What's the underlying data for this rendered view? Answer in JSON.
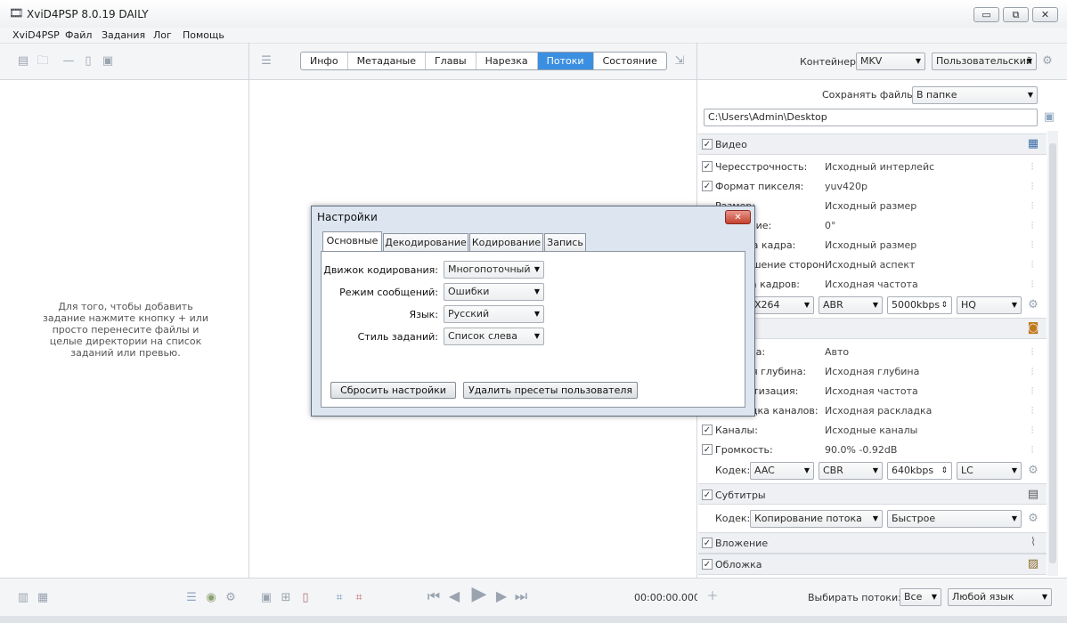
{
  "window": {
    "title": "XviD4PSP 8.0.19 DAILY",
    "min": "▭",
    "restore": "⧉",
    "close": "✕"
  },
  "menu": [
    "XviD4PSP",
    "Файл",
    "Задания",
    "Лог",
    "Помощь"
  ],
  "left_panel": {
    "hint": "Для того, чтобы добавить задание нажмите кнопку + или просто перенесите файлы и целые директории на список заданий или превью."
  },
  "tabs": [
    "Инфо",
    "Метаданые",
    "Главы",
    "Нарезка",
    "Потоки",
    "Состояние"
  ],
  "active_tab": "Потоки",
  "right_panel": {
    "container_label": "Контейнер:",
    "container_value": "MKV",
    "preset_value": "Пользовательский",
    "save_label": "Сохранять файлы:",
    "save_value": "В папке",
    "path": "C:\\Users\\Admin\\Desktop",
    "video": {
      "title": "Видео",
      "rows": [
        {
          "label": "Чересстрочность:",
          "value": "Исходный интерлейс"
        },
        {
          "label": "Формат пикселя:",
          "value": "yuv420p"
        },
        {
          "label": "Размер:",
          "value": "Исходный размер"
        },
        {
          "label": "Вращение:",
          "value": "0°"
        },
        {
          "label": "Обрезка кадра:",
          "value": "Исходный размер"
        },
        {
          "label": "Соотношение сторон:",
          "value": "Исходный аспект"
        },
        {
          "label": "Частота кадров:",
          "value": "Исходная частота"
        }
      ],
      "codec_visible": "X264",
      "mode": "ABR",
      "bitrate": "5000kbps",
      "profile": "HQ"
    },
    "audio": {
      "rows": [
        {
          "label": "Дорожка:",
          "value": "Авто"
        },
        {
          "label": "Битовая глубина:",
          "value": "Исходная глубина"
        },
        {
          "label": "Дискретизация:",
          "value": "Исходная частота"
        },
        {
          "label": "Раскладка каналов:",
          "value": "Исходная раскладка"
        },
        {
          "label": "Каналы:",
          "value": "Исходные каналы"
        },
        {
          "label": "Громкость:",
          "value": "90.0% -0.92dB"
        }
      ],
      "codec_label": "Кодек:",
      "codec": "AAC",
      "mode": "CBR",
      "bitrate": "640kbps",
      "profile": "LC"
    },
    "subtitles": {
      "title": "Субтитры",
      "codec_label": "Кодек:",
      "codec": "Копирование потока",
      "speed": "Быстрое"
    },
    "attachments": {
      "title": "Вложение"
    },
    "cover": {
      "title": "Обложка"
    },
    "streams_label": "Выбирать потоки:",
    "streams_value": "Все",
    "lang_value": "Любой язык"
  },
  "playback": {
    "time": "00:00:00.000"
  },
  "dialog": {
    "title": "Настройки",
    "tabs": [
      "Основные",
      "Декодирование",
      "Кодирование",
      "Запись"
    ],
    "fields": [
      {
        "label": "Движок кодирования:",
        "value": "Многопоточный"
      },
      {
        "label": "Режим сообщений:",
        "value": "Ошибки"
      },
      {
        "label": "Язык:",
        "value": "Русский"
      },
      {
        "label": "Стиль заданий:",
        "value": "Список слева"
      }
    ],
    "reset_button": "Сбросить настройки",
    "delete_button": "Удалить пресеты пользователя"
  }
}
